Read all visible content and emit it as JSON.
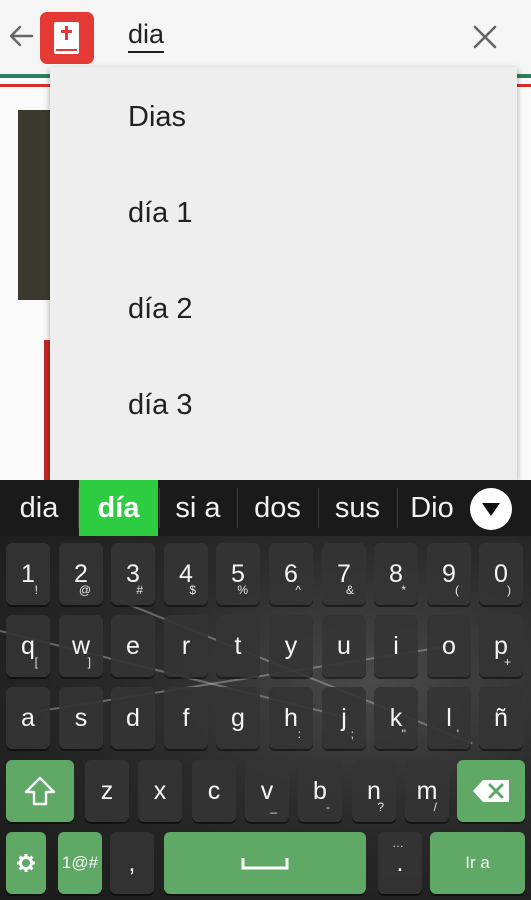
{
  "search": {
    "query": "dia",
    "back_icon": "arrow-left-icon",
    "app_icon": "bible-icon",
    "clear_icon": "close-icon"
  },
  "dropdown": {
    "items": [
      "Dias",
      "día 1",
      "día 2",
      "día 3"
    ]
  },
  "keyboard": {
    "suggestions": [
      "dia",
      "día",
      "si a",
      "dos",
      "sus",
      "Dio"
    ],
    "selected_suggestion": 1,
    "rows": [
      [
        {
          "k": "1",
          "s": "!"
        },
        {
          "k": "2",
          "s": "@"
        },
        {
          "k": "3",
          "s": "#"
        },
        {
          "k": "4",
          "s": "$"
        },
        {
          "k": "5",
          "s": "%"
        },
        {
          "k": "6",
          "s": "^"
        },
        {
          "k": "7",
          "s": "&"
        },
        {
          "k": "8",
          "s": "*"
        },
        {
          "k": "9",
          "s": "("
        },
        {
          "k": "0",
          "s": ")"
        }
      ],
      [
        {
          "k": "q",
          "s": "["
        },
        {
          "k": "w",
          "s": "]"
        },
        {
          "k": "e",
          "s": ""
        },
        {
          "k": "r",
          "s": ""
        },
        {
          "k": "t",
          "s": ""
        },
        {
          "k": "y",
          "s": ""
        },
        {
          "k": "u",
          "s": ""
        },
        {
          "k": "i",
          "s": ""
        },
        {
          "k": "o",
          "s": ""
        },
        {
          "k": "p",
          "s": "+"
        }
      ],
      [
        {
          "k": "a",
          "s": ""
        },
        {
          "k": "s",
          "s": ""
        },
        {
          "k": "d",
          "s": ""
        },
        {
          "k": "f",
          "s": ""
        },
        {
          "k": "g",
          "s": ""
        },
        {
          "k": "h",
          "s": ":"
        },
        {
          "k": "j",
          "s": ";"
        },
        {
          "k": "k",
          "s": "\""
        },
        {
          "k": "l",
          "s": "'"
        },
        {
          "k": "ñ",
          "s": ""
        }
      ],
      [
        {
          "k": "z",
          "s": ""
        },
        {
          "k": "x",
          "s": ""
        },
        {
          "k": "c",
          "s": ""
        },
        {
          "k": "v",
          "s": "_"
        },
        {
          "k": "b",
          "s": "-"
        },
        {
          "k": "n",
          "s": "?"
        },
        {
          "k": "m",
          "s": "/"
        }
      ]
    ],
    "symbols_label": "1@#",
    "comma_label": ",",
    "period_label": ".",
    "period_sub": "…",
    "enter_label": "Ir a",
    "colors": {
      "accent": "#2ecc40",
      "key_green": "#5fa865"
    }
  }
}
